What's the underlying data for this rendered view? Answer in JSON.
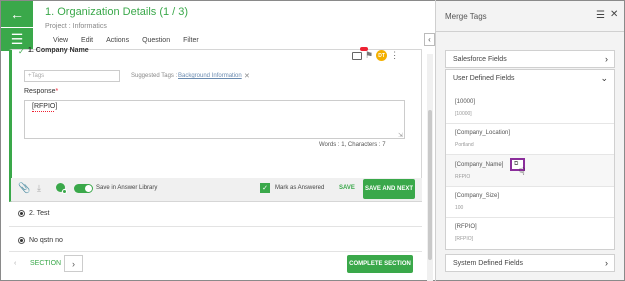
{
  "header": {
    "title": "1. Organization Details  (1 / 3)",
    "subtitle": "Project : Informatics",
    "menu": [
      "View",
      "Edit",
      "Actions",
      "Question",
      "Filter"
    ]
  },
  "rail": {
    "back_icon": "arrow-left-icon",
    "menu_icon": "hamburger-icon"
  },
  "question": {
    "title": "1. Company Name",
    "user_initials": "DT",
    "tags_placeholder": "+Tags",
    "suggested_label": "Suggested Tags :",
    "suggested_tag": "Background Information",
    "response_label": "Response",
    "response_value": "[RFPIO]",
    "word_count": "Words : 1, Characters : 7",
    "save_library": "Save in Answer Library",
    "mark_answered": "Mark as Answered",
    "save": "SAVE",
    "save_next": "SAVE AND NEXT"
  },
  "other_questions": [
    {
      "label": "2. Test"
    },
    {
      "label": "No qstn no"
    }
  ],
  "footer": {
    "section": "SECTION",
    "complete": "COMPLETE SECTION"
  },
  "merge_panel": {
    "title": "Merge Tags",
    "salesforce": "Salesforce Fields",
    "user_defined": "User Defined Fields",
    "system_defined": "System Defined Fields",
    "tags": [
      {
        "name": "[10000]",
        "value": "[10000]"
      },
      {
        "name": "[Company_Location]",
        "value": "Portland"
      },
      {
        "name": "[Company_Name]",
        "value": "RFPIO"
      },
      {
        "name": "[Company_Size]",
        "value": "100"
      },
      {
        "name": "[RFPIO]",
        "value": "[RFPIO]"
      }
    ]
  },
  "colors": {
    "accent": "#3aa84a",
    "highlight": "#8b2e9b"
  }
}
